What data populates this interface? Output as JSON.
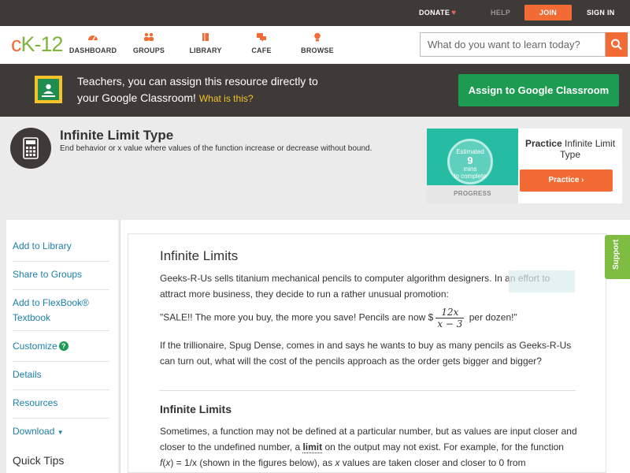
{
  "topbar": {
    "donate": "DONATE",
    "help": "HELP",
    "join": "JOIN",
    "signin": "SIGN IN"
  },
  "nav": {
    "logo_c": "c",
    "logo_k": "K",
    "logo_dash": "-",
    "logo_num": "12",
    "items": [
      {
        "label": "DASHBOARD",
        "icon": "dashboard-icon"
      },
      {
        "label": "GROUPS",
        "icon": "groups-icon"
      },
      {
        "label": "LIBRARY",
        "icon": "library-icon"
      },
      {
        "label": "CAFE",
        "icon": "cafe-icon"
      },
      {
        "label": "BROWSE",
        "icon": "browse-icon"
      }
    ],
    "search_placeholder": "What do you want to learn today?"
  },
  "banner": {
    "line1": "Teachers, you can assign this resource directly to",
    "line2": "your Google Classroom!",
    "what": "What is this?",
    "assign_button": "Assign to Google Classroom"
  },
  "header": {
    "title": "Infinite Limit Type",
    "subtitle": "End behavior or x value where values of the function increase or decrease without bound."
  },
  "practice": {
    "estimated": "Estimated",
    "mins_num": "9",
    "mins_label": "mins",
    "to_complete": "to complete",
    "progress_label": "PROGRESS",
    "practice_bold": "Practice",
    "practice_title_rest": "Infinite Limit Type",
    "practice_button": "Practice"
  },
  "sidebar": {
    "items": [
      {
        "label": "Add to Library"
      },
      {
        "label": "Share to Groups"
      },
      {
        "label": "Add to FlexBook®",
        "label2": "Textbook"
      },
      {
        "label": "Customize"
      },
      {
        "label": "Details"
      },
      {
        "label": "Resources"
      },
      {
        "label": "Download"
      }
    ],
    "help_glyph": "?",
    "download_arrow": "▼",
    "quick_tips": "Quick Tips"
  },
  "content": {
    "title": "Infinite Limits",
    "p1": "Geeks-R-Us sells titanium mechanical pencils to computer algorithm designers. In an effort to attract more business, they decide to run a rather unusual promotion:",
    "p2_before": "\"SALE!! The more you buy, the more you save! Pencils are now $",
    "frac_num": "12x",
    "frac_den": "x − 3",
    "p2_after": " per dozen!\"",
    "p3": "If the trillionaire, Spug Dense, comes in and says he wants to buy as many pencils as Geeks-R-Us can turn out, what will the cost of the pencils approach as the order gets bigger and bigger?",
    "h2": "Infinite Limits",
    "p4_a": "Sometimes, a function may not be defined at a particular number, but as values are input closer and closer to the undefined number, a ",
    "p4_kw": "limit",
    "p4_b": " on the output may not exist. For example, for the function ",
    "p4_f": "f",
    "p4_c": "(",
    "p4_x": "x",
    "p4_d": ") = 1/x (shown in the figures below), as ",
    "p4_x2": "x",
    "p4_e": " values are taken closer and closer to 0 from"
  },
  "support": "Support",
  "colors": {
    "accent": "#f26b35",
    "green": "#1e9b52",
    "dark": "#3e3a38",
    "link": "#1d80a9",
    "teal": "#26bba3"
  }
}
